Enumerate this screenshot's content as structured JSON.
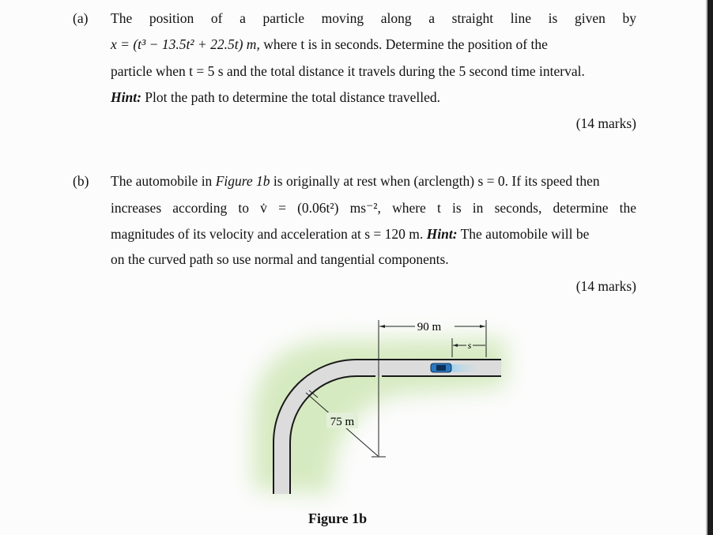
{
  "part_a": {
    "label": "(a)",
    "line1": "The position of a particle moving along a straight line is given by",
    "line2_eq": "x = (t³ − 13.5t² + 22.5t) m,",
    "line2_rest": "where t is in seconds. Determine the position of the",
    "line3": "particle when t = 5 s and the total distance it travels during the 5 second time interval.",
    "hint_label": "Hint:",
    "hint_text": "Plot the path to determine the total distance travelled.",
    "marks": "(14 marks)"
  },
  "part_b": {
    "label": "(b)",
    "line1_pre": "The automobile in",
    "line1_fig": "Figure 1b",
    "line1_post": "is originally at rest when (arclength) s = 0. If its speed then",
    "line2": "increases according to v̇ = (0.06t²) ms⁻², where t is in seconds, determine the",
    "line3_pre": "magnitudes of its velocity and acceleration at s = 120 m.",
    "hint_label": "Hint:",
    "line3_post": "The automobile will be",
    "line4": "on the curved path so use normal and tangential components.",
    "marks": "(14 marks)"
  },
  "figure": {
    "caption": "Figure 1b",
    "dim_straight": "90 m",
    "dim_s": "s",
    "dim_radius": "75 m",
    "colors": {
      "grass": "#dbecc8",
      "road": "#dedede",
      "car": "#2a78c0"
    }
  }
}
